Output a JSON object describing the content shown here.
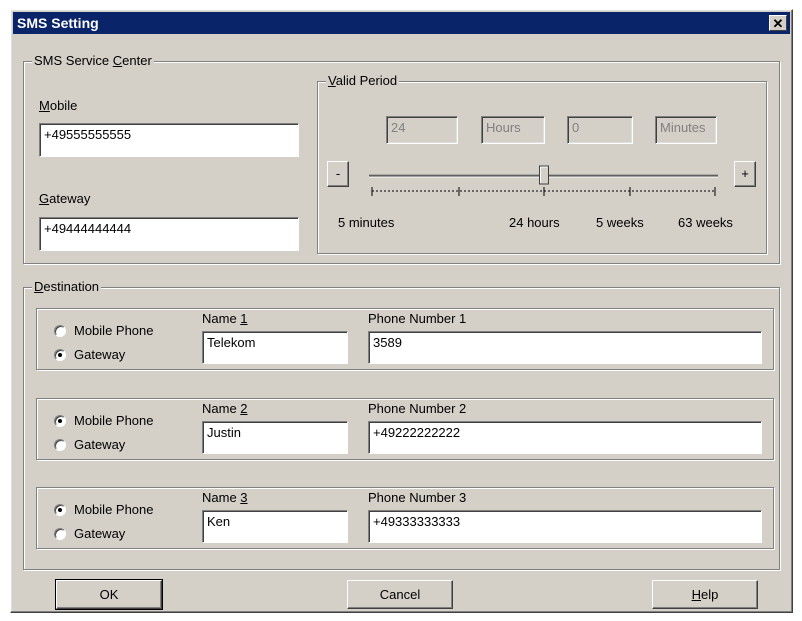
{
  "window": {
    "title": "SMS Setting",
    "close_glyph": "✕"
  },
  "service_center": {
    "legend_pre": "SMS Service ",
    "legend_acc": "C",
    "legend_post": "enter",
    "mobile_label_acc": "M",
    "mobile_label_rest": "obile",
    "mobile_value": "+49555555555",
    "gateway_label_acc": "G",
    "gateway_label_rest": "ateway",
    "gateway_value": "+49444444444"
  },
  "valid_period": {
    "legend_acc": "V",
    "legend_rest": "alid Period",
    "hours_value": "24",
    "hours_unit": "Hours",
    "minutes_value": "0",
    "minutes_unit": "Minutes",
    "minus_label": "-",
    "plus_label": "+",
    "slider_level": 0.5,
    "scale_labels": [
      "5 minutes",
      "24 hours",
      "5 weeks",
      "63 weeks"
    ]
  },
  "destination": {
    "legend_acc": "D",
    "legend_rest": "estination",
    "radio_mobile": "Mobile Phone",
    "radio_gateway": "Gateway",
    "entries": [
      {
        "name_label_pre": "Name ",
        "name_label_acc": "1",
        "name_value": "Telekom",
        "phone_label": "Phone Number 1",
        "phone_value": "3589",
        "selected": "gateway"
      },
      {
        "name_label_pre": "Name ",
        "name_label_acc": "2",
        "name_value": "Justin",
        "phone_label": "Phone Number 2",
        "phone_value": "+49222222222",
        "selected": "mobile"
      },
      {
        "name_label_pre": "Name ",
        "name_label_acc": "3",
        "name_value": "Ken",
        "phone_label": "Phone Number 3",
        "phone_value": "+49333333333",
        "selected": "mobile"
      }
    ]
  },
  "buttons": {
    "ok": "OK",
    "cancel": "Cancel",
    "help_acc": "H",
    "help_rest": "elp"
  }
}
